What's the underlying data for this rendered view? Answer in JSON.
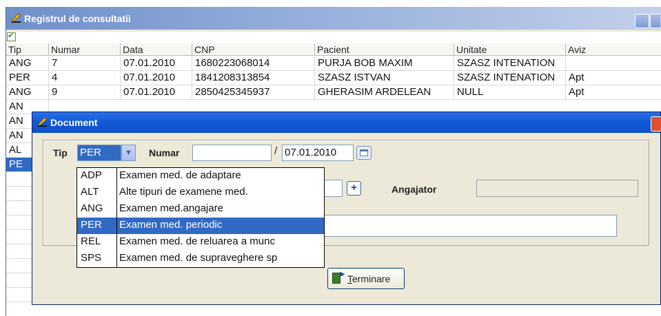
{
  "main_window": {
    "title": "Registrul de consultatii"
  },
  "grid": {
    "columns": [
      "Tip",
      "Numar",
      "Data",
      "CNP",
      "Pacient",
      "Unitate",
      "Aviz"
    ],
    "rows": [
      {
        "tip": "ANG",
        "numar": "7",
        "data": "07.01.2010",
        "cnp": "1680223068014",
        "pacient": "PURJA BOB MAXIM",
        "unitate": "SZASZ INTENATION",
        "aviz": ""
      },
      {
        "tip": "PER",
        "numar": "4",
        "data": "07.01.2010",
        "cnp": "1841208313854",
        "pacient": "SZASZ ISTVAN",
        "unitate": "SZASZ INTENATION",
        "aviz": "Apt"
      },
      {
        "tip": "ANG",
        "numar": "9",
        "data": "07.01.2010",
        "cnp": "2850425345937",
        "pacient": "GHERASIM ARDELEAN",
        "unitate": "NULL",
        "aviz": "Apt"
      },
      {
        "tip": "AN",
        "numar": "",
        "data": "",
        "cnp": "",
        "pacient": "",
        "unitate": "",
        "aviz": ""
      },
      {
        "tip": "AN",
        "numar": "",
        "data": "",
        "cnp": "",
        "pacient": "",
        "unitate": "",
        "aviz": ""
      },
      {
        "tip": "AN",
        "numar": "",
        "data": "",
        "cnp": "",
        "pacient": "",
        "unitate": "",
        "aviz": ""
      },
      {
        "tip": "AL",
        "numar": "",
        "data": "",
        "cnp": "",
        "pacient": "",
        "unitate": "",
        "aviz": ""
      },
      {
        "tip": "PE",
        "numar": "",
        "data": "",
        "cnp": "",
        "pacient": "",
        "unitate": "",
        "aviz": ""
      }
    ]
  },
  "dialog": {
    "title": "Document",
    "tip_label": "Tip",
    "tip_value": "PER",
    "numar_label": "Numar",
    "numar_value": "",
    "date_separator": "/",
    "date_value": "07.01.2010",
    "plus_label": "+",
    "angajator_label": "Angajator",
    "angajator_value": "",
    "terminare_hotkey": "T",
    "terminare_rest": "erminare",
    "tip_options": [
      {
        "code": "ADP",
        "description": "Examen med. de adaptare"
      },
      {
        "code": "ALT",
        "description": "Alte tipuri de examene med."
      },
      {
        "code": "ANG",
        "description": "Examen med.angajare"
      },
      {
        "code": "PER",
        "description": "Examen med. periodic"
      },
      {
        "code": "REL",
        "description": "Examen med. de reluarea a munc"
      },
      {
        "code": "SPS",
        "description": "Examen med. de supraveghere sp"
      }
    ],
    "selected_option": "PER"
  },
  "colors": {
    "selection": "#316ac5",
    "dialog_titlebar": "#1258d6",
    "main_titlebar": "#95aedb",
    "window_face": "#ece9d8"
  }
}
